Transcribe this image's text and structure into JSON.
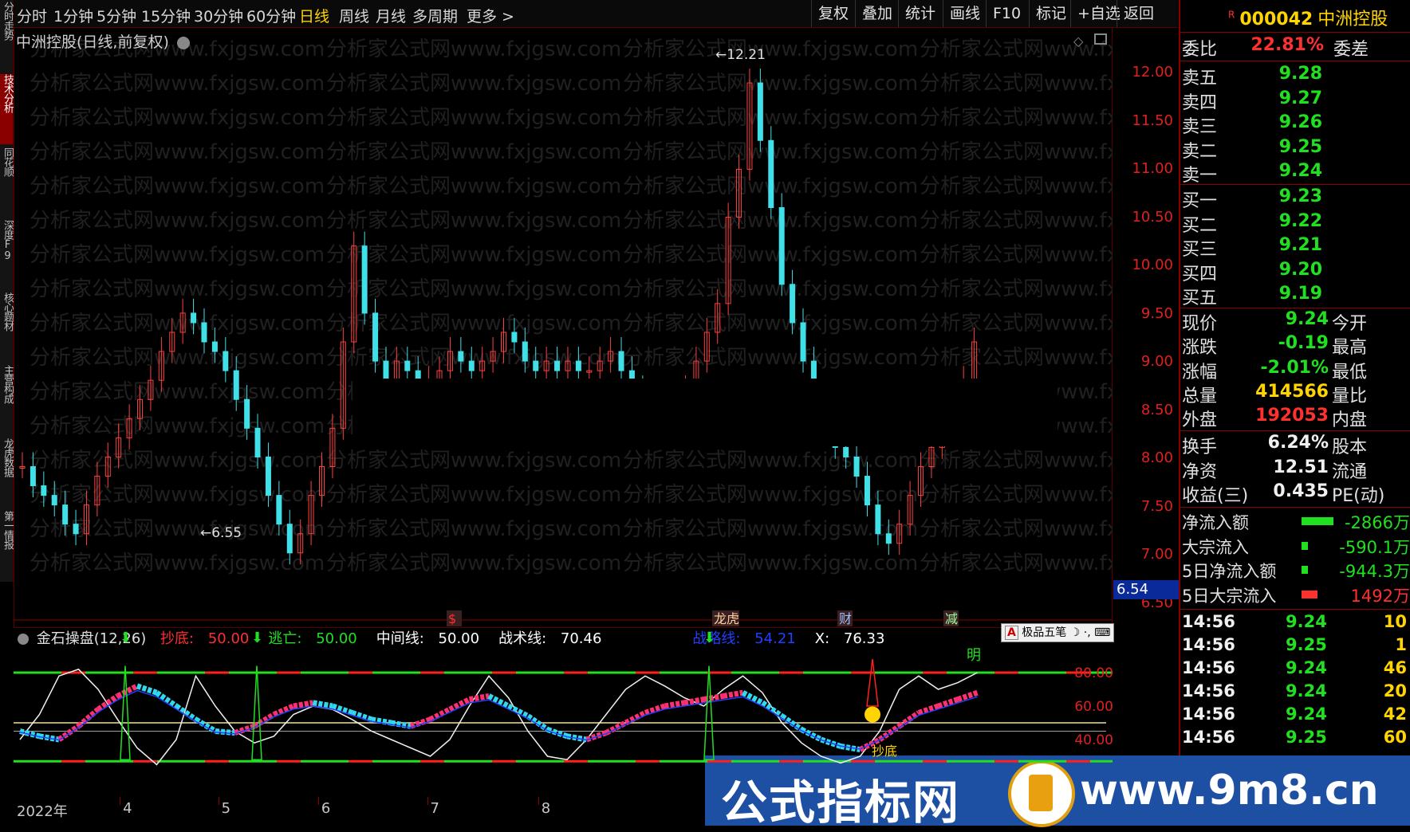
{
  "left_tabs": [
    "分时走势",
    "技术分析",
    "同花顺",
    "深度F9",
    "核心题材",
    "主营构成",
    "龙虎数据",
    "第一情报"
  ],
  "left_tab_active": 1,
  "toolbar": {
    "periods": [
      "分时",
      "1分钟",
      "5分钟",
      "15分钟",
      "30分钟",
      "60分钟",
      "日线",
      "周线",
      "月线",
      "多周期",
      "更多 >"
    ],
    "active_period": "日线",
    "right_buttons": [
      "复权",
      "叠加",
      "统计",
      "画线",
      "F10",
      "标记",
      "+自选",
      "返回"
    ]
  },
  "chart": {
    "title": "中洲控股(日线,前复权)",
    "high_label": "12.21",
    "low_label": "6.55",
    "last_price": "6.54",
    "watermark": "分析家公式网www.fxjgsw.com",
    "price_axis": [
      "12.00",
      "11.50",
      "11.00",
      "10.50",
      "10.00",
      "9.50",
      "9.00",
      "8.50",
      "8.00",
      "7.50",
      "7.00",
      "6.50"
    ],
    "markers": [
      "$",
      "龙虎",
      "财",
      "减"
    ]
  },
  "indicator": {
    "name": "金石操盘(12,26)",
    "items": [
      {
        "label": "抄底:",
        "value": "50.00",
        "color": "#ff3030"
      },
      {
        "label": "逃亡:",
        "value": "50.00",
        "color": "#20e020"
      },
      {
        "label": "中间线:",
        "value": "50.00",
        "color": "#ffffff"
      },
      {
        "label": "战术线:",
        "value": "70.46",
        "color": "#ffffff"
      },
      {
        "label": "战略线:",
        "value": "54.21",
        "color": "#2040ff"
      },
      {
        "label": "X:",
        "value": "76.33",
        "color": "#ffffff"
      }
    ],
    "axis": [
      "80.00",
      "60.00",
      "40.00"
    ],
    "tag_right": "明",
    "tag_bottom": "抄底"
  },
  "ime": {
    "label": "极品五笔"
  },
  "date_axis": [
    {
      "label": "2022年",
      "pos": 0
    },
    {
      "label": "4",
      "pos": 0.153
    },
    {
      "label": "5",
      "pos": 0.295
    },
    {
      "label": "6",
      "pos": 0.439
    },
    {
      "label": "7",
      "pos": 0.596
    },
    {
      "label": "8",
      "pos": 0.756
    }
  ],
  "quote": {
    "code_prefix": "R",
    "code": "000042",
    "name": "中洲控股",
    "weibi_label": "委比",
    "weibi_value": "22.81%",
    "weicha_label": "委差",
    "sell": [
      {
        "label": "卖五",
        "price": "9.28"
      },
      {
        "label": "卖四",
        "price": "9.27"
      },
      {
        "label": "卖三",
        "price": "9.26"
      },
      {
        "label": "卖二",
        "price": "9.25"
      },
      {
        "label": "卖一",
        "price": "9.24"
      }
    ],
    "buy": [
      {
        "label": "买一",
        "price": "9.23"
      },
      {
        "label": "买二",
        "price": "9.22"
      },
      {
        "label": "买三",
        "price": "9.21"
      },
      {
        "label": "买四",
        "price": "9.20"
      },
      {
        "label": "买五",
        "price": "9.19"
      }
    ],
    "stats": [
      {
        "label": "现价",
        "value": "9.24",
        "color": "#20e020",
        "label2": "今开"
      },
      {
        "label": "涨跌",
        "value": "-0.19",
        "color": "#20e020",
        "label2": "最高"
      },
      {
        "label": "涨幅",
        "value": "-2.01%",
        "color": "#20e020",
        "label2": "最低"
      },
      {
        "label": "总量",
        "value": "414566",
        "color": "#ffd400",
        "label2": "量比"
      },
      {
        "label": "外盘",
        "value": "192053",
        "color": "#ff3030",
        "label2": "内盘"
      }
    ],
    "stats2": [
      {
        "label": "换手",
        "value": "6.24%",
        "label2": "股本"
      },
      {
        "label": "净资",
        "value": "12.51",
        "label2": "流通"
      },
      {
        "label": "收益(三)",
        "value": "0.435",
        "label2": "PE(动)"
      }
    ],
    "flows": [
      {
        "label": "净流入额",
        "value": "-2866万",
        "bar": 0.9,
        "color": "#20e020"
      },
      {
        "label": "大宗流入",
        "value": "-590.1万",
        "bar": 0.12,
        "color": "#20e020"
      },
      {
        "label": "5日净流入额",
        "value": "-944.3万",
        "bar": 0.18,
        "color": "#20e020"
      },
      {
        "label": "5日大宗流入",
        "value": "1492万",
        "bar": 0.45,
        "color": "#ff3030"
      }
    ],
    "ticks": [
      {
        "time": "14:56",
        "price": "9.24",
        "vol": "10"
      },
      {
        "time": "14:56",
        "price": "9.25",
        "vol": "1"
      },
      {
        "time": "14:56",
        "price": "9.24",
        "vol": "46"
      },
      {
        "time": "14:56",
        "price": "9.24",
        "vol": "20"
      },
      {
        "time": "14:56",
        "price": "9.24",
        "vol": "42"
      },
      {
        "time": "14:56",
        "price": "9.25",
        "vol": "60"
      }
    ]
  },
  "banner": {
    "cn": "公式指标网",
    "url": "www.9m8.cn"
  }
}
